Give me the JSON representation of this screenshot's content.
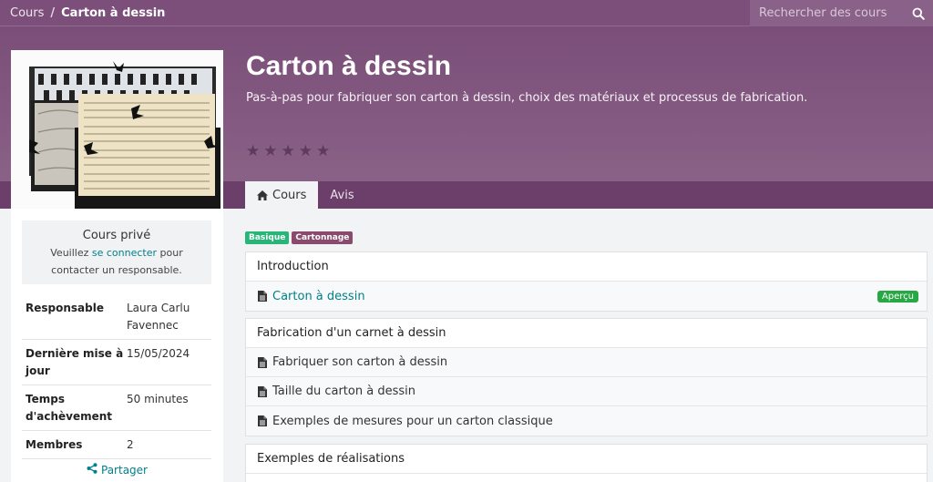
{
  "breadcrumb": {
    "root": "Cours",
    "separator": "/",
    "current": "Carton à dessin"
  },
  "search": {
    "placeholder": "Rechercher des cours"
  },
  "course": {
    "title": "Carton à dessin",
    "subtitle": "Pas-à-pas pour fabriquer son carton à dessin, choix des matériaux et processus de fabrication.",
    "rating_stars": 5
  },
  "tabs": [
    {
      "label": "Cours",
      "icon": "home-icon",
      "active": true
    },
    {
      "label": "Avis",
      "active": false
    }
  ],
  "private_box": {
    "title": "Cours privé",
    "msg_before": "Veuillez ",
    "msg_link": "se connecter",
    "msg_after": " pour contacter un responsable."
  },
  "info": [
    {
      "key": "Responsable",
      "value": "Laura Carlu Favennec"
    },
    {
      "key": "Dernière mise à jour",
      "value": "15/05/2024"
    },
    {
      "key": "Temps d'achèvement",
      "value": "50 minutes"
    },
    {
      "key": "Membres",
      "value": "2"
    }
  ],
  "share": {
    "label": "Partager"
  },
  "tags": [
    "Basique",
    "Cartonnage"
  ],
  "sections": [
    {
      "title": "Introduction",
      "lessons": [
        {
          "label": "Carton à dessin",
          "link": true,
          "badge": "Aperçu"
        }
      ]
    },
    {
      "title": "Fabrication d'un carnet à dessin",
      "lessons": [
        {
          "label": "Fabriquer son carton à dessin"
        },
        {
          "label": "Taille du carton à dessin"
        },
        {
          "label": "Exemples de mesures pour un carton classique"
        }
      ]
    },
    {
      "title": "Exemples de réalisations",
      "lessons": []
    }
  ],
  "colors": {
    "brand": "#7b4f79",
    "link": "#01808a",
    "success": "#28a745"
  }
}
